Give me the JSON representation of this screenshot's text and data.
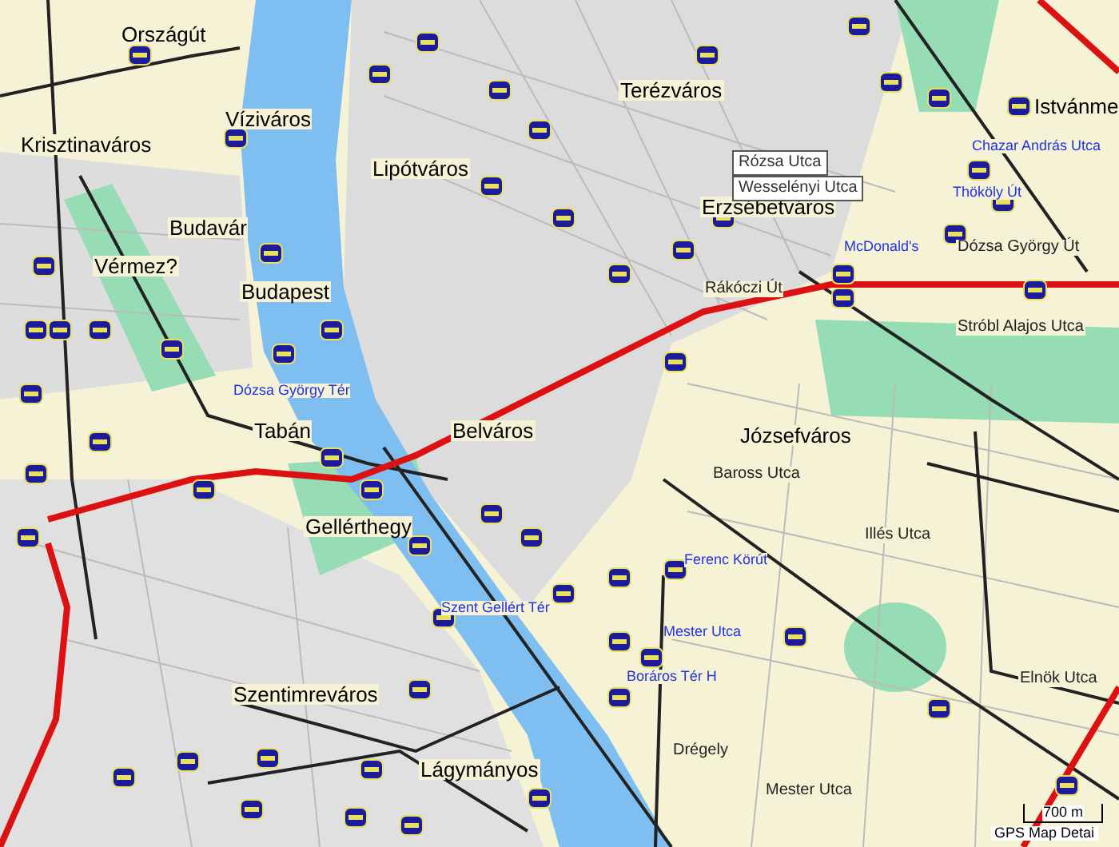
{
  "map": {
    "districts": [
      "Országút",
      "Víziváros",
      "Krisztinaváros",
      "Budavár",
      "Vérmez?",
      "Budapest",
      "Tabán",
      "Belváros",
      "Gellérthegy",
      "Szentimreváros",
      "Lágymányos",
      "Terézváros",
      "Lipótváros",
      "Erzsébetváros",
      "Istvánme",
      "Józsefváros"
    ],
    "streets": [
      "Baross Utca",
      "Dózsa György Út",
      "Stróbl Alajos Utca",
      "Rákóczi Út",
      "Illés Utca",
      "Elnök Utca",
      "Drégely",
      "Mester Utca"
    ],
    "places": [
      "Ferenc Körút",
      "Mester Utca",
      "Boráros Tér H",
      "Thököly Út",
      "Chazar András Utca",
      "McDonald's",
      "Dózsa György Tér",
      "Szent Gellért Tér"
    ],
    "hover_labels": [
      "Rózsa Utca",
      "Wesselényi Utca"
    ],
    "scale": {
      "label": "700 m"
    },
    "footer": "GPS Map Detai"
  }
}
